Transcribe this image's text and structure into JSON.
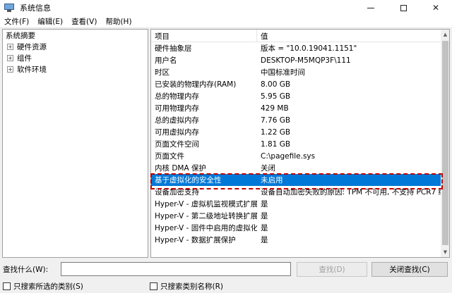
{
  "window": {
    "title": "系统信息",
    "icon": "system-info-icon"
  },
  "menu": [
    {
      "label": "文件(F)"
    },
    {
      "label": "编辑(E)"
    },
    {
      "label": "查看(V)"
    },
    {
      "label": "帮助(H)"
    }
  ],
  "tree": {
    "root": "系统摘要",
    "children": [
      {
        "label": "硬件资源",
        "expander": "+"
      },
      {
        "label": "组件",
        "expander": "+"
      },
      {
        "label": "软件环境",
        "expander": "+"
      }
    ]
  },
  "list": {
    "columns": [
      "项目",
      "值"
    ],
    "rows": [
      {
        "key": "硬件抽象层",
        "value": "版本 = \"10.0.19041.1151\""
      },
      {
        "key": "用户名",
        "value": "DESKTOP-M5MQP3F\\111"
      },
      {
        "key": "时区",
        "value": "中国标准时间"
      },
      {
        "key": "已安装的物理内存(RAM)",
        "value": "8.00 GB"
      },
      {
        "key": "总的物理内存",
        "value": "5.95 GB"
      },
      {
        "key": "可用物理内存",
        "value": "429 MB"
      },
      {
        "key": "总的虚拟内存",
        "value": "7.76 GB"
      },
      {
        "key": "可用虚拟内存",
        "value": "1.22 GB"
      },
      {
        "key": "页面文件空间",
        "value": "1.81 GB"
      },
      {
        "key": "页面文件",
        "value": "C:\\pagefile.sys"
      },
      {
        "key": "内核 DMA 保护",
        "value": "关闭"
      },
      {
        "key": "基于虚拟化的安全性",
        "value": "未启用",
        "selected": true
      },
      {
        "key": "设备加密支持",
        "value": "设备自动加密失败的原因: TPM 不可用, 不支持 PCR7 绑定, "
      },
      {
        "key": "Hyper-V - 虚拟机监视模式扩展",
        "value": "是"
      },
      {
        "key": "Hyper-V - 第二级地址转换扩展",
        "value": "是"
      },
      {
        "key": "Hyper-V - 固件中启用的虚拟化",
        "value": "是"
      },
      {
        "key": "Hyper-V - 数据扩展保护",
        "value": "是"
      }
    ]
  },
  "search": {
    "label": "查找什么(W):",
    "value": "",
    "find_button": "查找(D)",
    "close_find_button": "关闭查找(C)"
  },
  "options": {
    "search_selected_category": "只搜索所选的类别(S)",
    "search_category_names": "只搜索类别名称(R)"
  },
  "colors": {
    "selection": "#0078d7",
    "highlight_border": "#c00000"
  }
}
